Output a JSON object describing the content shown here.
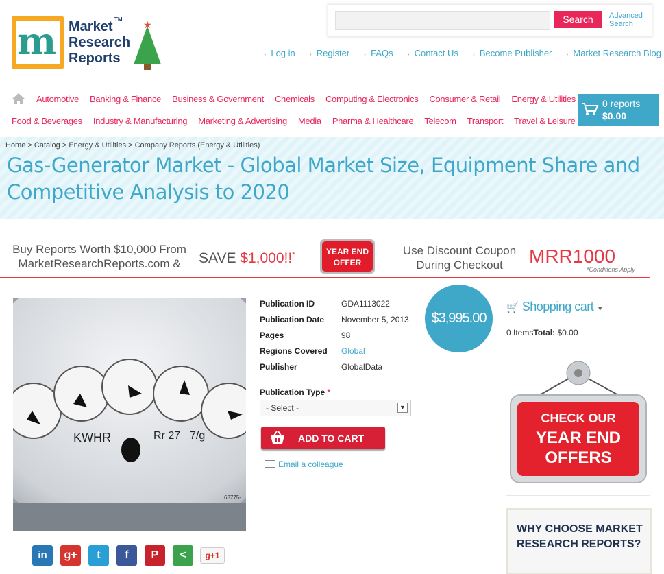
{
  "header": {
    "logo_lines": [
      "Market",
      "Research",
      "Reports"
    ],
    "logo_tm": "TM",
    "search": {
      "placeholder": "",
      "button_label": "Search",
      "advanced_label": "Advanced Search"
    },
    "top_links": [
      "Log in",
      "Register",
      "FAQs",
      "Contact Us",
      "Become Publisher",
      "Market Research Blog"
    ]
  },
  "nav": {
    "row1": [
      "Automotive",
      "Banking & Finance",
      "Business & Government",
      "Chemicals",
      "Computing & Electronics",
      "Consumer & Retail",
      "Energy & Utilities"
    ],
    "row2": [
      "Food & Beverages",
      "Industry & Manufacturing",
      "Marketing & Advertising",
      "Media",
      "Pharma & Healthcare",
      "Telecom",
      "Transport",
      "Travel & Leisure"
    ],
    "cart": {
      "count_label": "0 reports",
      "total_label": "$0.00"
    }
  },
  "breadcrumb": "Home > Catalog > Energy & Utilities > Company Reports (Energy & Utilities)",
  "title": "Gas-Generator Market - Global Market Size, Equipment Share and Competitive Analysis to 2020",
  "promo": {
    "left": "Buy Reports Worth $10,000 From MarketResearchReports.com &",
    "save_prefix": "SAVE ",
    "save_amount": "$1,000!!",
    "save_star": "*",
    "badge_line1": "YEAR END",
    "badge_line2": "OFFER",
    "right": "Use Discount Coupon During Checkout",
    "code": "MRR1000",
    "conditions": "*Conditions Apply"
  },
  "product_image_labels": {
    "kwhr": "KWHR",
    "rr": "Rr 27",
    "ratio": "7/g",
    "serial": "68775-"
  },
  "details": {
    "publication_id_label": "Publication ID",
    "publication_id": "GDA1113022",
    "publication_date_label": "Publication Date",
    "publication_date": "November 5, 2013",
    "pages_label": "Pages",
    "pages": "98",
    "regions_label": "Regions Covered",
    "regions": "Global",
    "publisher_label": "Publisher",
    "publisher": "GlobalData",
    "price": "$3,995.00",
    "pub_type_label": "Publication Type",
    "pub_type_required": "*",
    "pub_type_value": "- Select -",
    "add_to_cart": "ADD TO CART",
    "email_colleague": "Email a colleague"
  },
  "sidebar": {
    "cart_title": "Shopping cart",
    "items_label": "0 Items",
    "total_label": "Total:",
    "total_value": "$0.00",
    "offer_line1": "CHECK OUR",
    "offer_line2": "YEAR END",
    "offer_line3": "OFFERS",
    "why_choose": "WHY CHOOSE MARKET RESEARCH REPORTS?"
  },
  "social": {
    "linkedin": "in",
    "gplus": "g+",
    "twitter": "t",
    "facebook": "f",
    "pinterest": "P",
    "share": "<",
    "gplus_one": "g+1"
  },
  "colors": {
    "brand_blue": "#3fa8c9",
    "brand_pink": "#e8265a",
    "red": "#d71f35"
  }
}
